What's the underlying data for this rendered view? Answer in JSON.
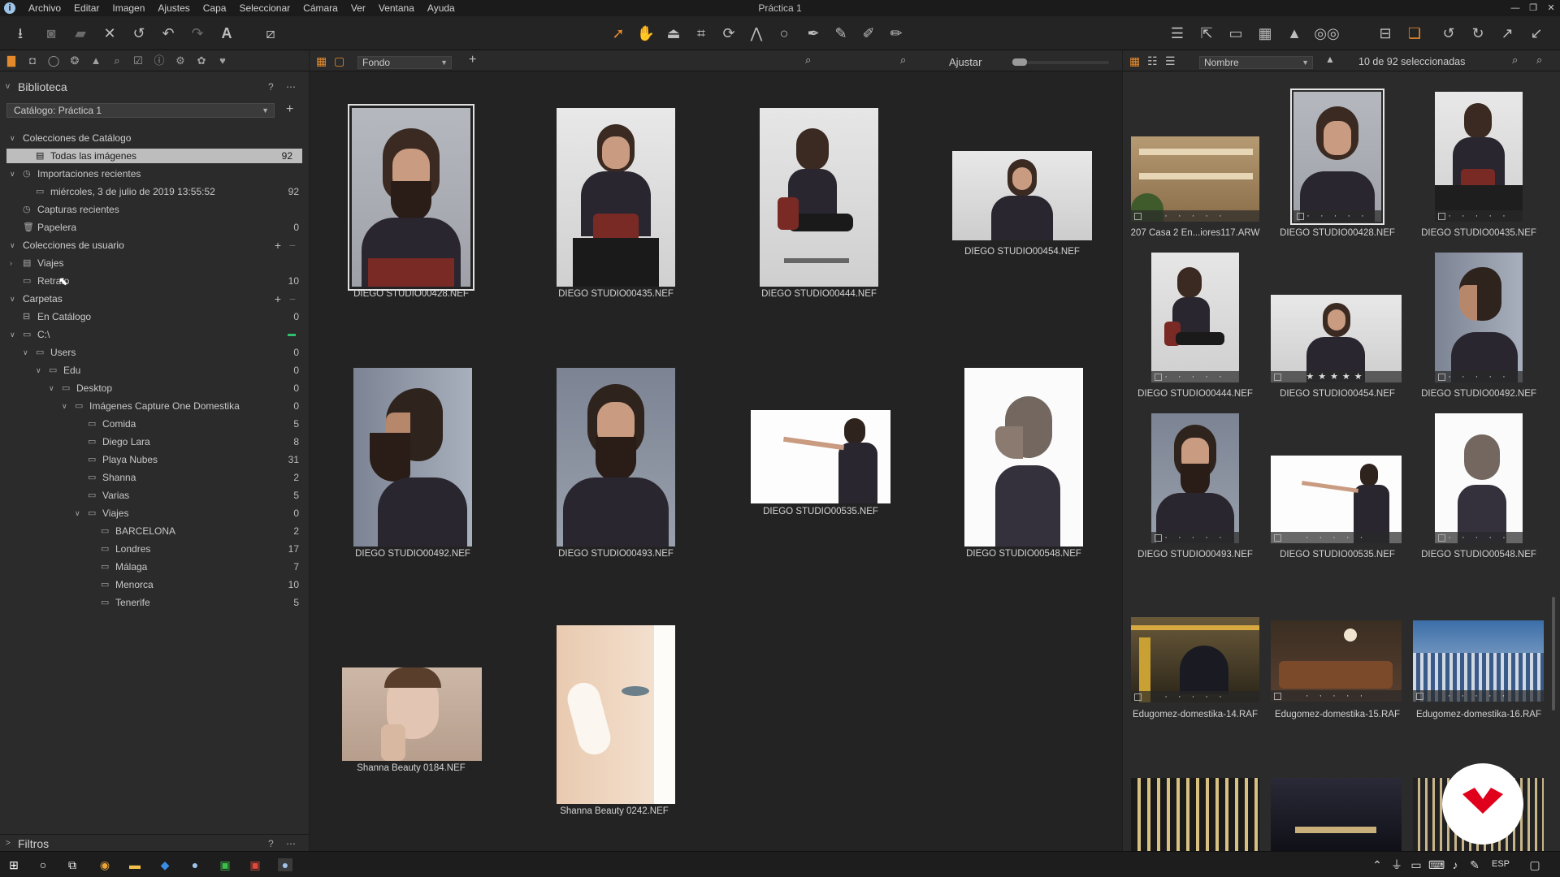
{
  "menu": [
    "Archivo",
    "Editar",
    "Imagen",
    "Ajustes",
    "Capa",
    "Seleccionar",
    "Cámara",
    "Ver",
    "Ventana",
    "Ayuda"
  ],
  "window_title": "Práctica 1",
  "library": {
    "title": "Biblioteca",
    "catalog": "Catálogo: Práctica 1"
  },
  "tree": [
    {
      "label": "Colecciones de Catálogo",
      "count": "",
      "indent": 0,
      "chev": "v",
      "icon": "",
      "section": true
    },
    {
      "label": "Todas las imágenes",
      "count": "92",
      "indent": 1,
      "chev": "",
      "icon": "all-images-icon",
      "selected": true
    },
    {
      "label": "Importaciones recientes",
      "count": "",
      "indent": 0,
      "chev": "v",
      "icon": "clock-icon"
    },
    {
      "label": "miércoles, 3 de julio de 2019 13:55:52",
      "count": "92",
      "indent": 1,
      "chev": "",
      "icon": "import-icon"
    },
    {
      "label": "Capturas recientes",
      "count": "",
      "indent": 0,
      "chev": "",
      "icon": "clock-icon"
    },
    {
      "label": "Papelera",
      "count": "0",
      "indent": 0,
      "chev": "",
      "icon": "trash-icon"
    },
    {
      "label": "Colecciones de usuario",
      "count": "",
      "indent": 0,
      "chev": "v",
      "icon": "",
      "section": true,
      "plusminus": true
    },
    {
      "label": "Viajes",
      "count": "",
      "indent": 0,
      "chev": ">",
      "icon": "project-icon"
    },
    {
      "label": "Retrato",
      "count": "10",
      "indent": 0,
      "chev": "",
      "icon": "album-icon"
    },
    {
      "label": "Carpetas",
      "count": "",
      "indent": 0,
      "chev": "v",
      "icon": "",
      "section": true,
      "plusminus": true
    },
    {
      "label": "En Catálogo",
      "count": "0",
      "indent": 0,
      "chev": "",
      "icon": "catalog-icon"
    },
    {
      "label": "C:\\",
      "count": "",
      "indent": 0,
      "chev": "v",
      "icon": "drive-icon",
      "green": true
    },
    {
      "label": "Users",
      "count": "0",
      "indent": 1,
      "chev": "v",
      "icon": "folder-icon"
    },
    {
      "label": "Edu",
      "count": "0",
      "indent": 2,
      "chev": "v",
      "icon": "folder-icon"
    },
    {
      "label": "Desktop",
      "count": "0",
      "indent": 3,
      "chev": "v",
      "icon": "folder-icon"
    },
    {
      "label": "Imágenes Capture One Domestika",
      "count": "0",
      "indent": 4,
      "chev": "v",
      "icon": "folder-icon"
    },
    {
      "label": "Comida",
      "count": "5",
      "indent": 5,
      "chev": "",
      "icon": "folder-icon"
    },
    {
      "label": "Diego Lara",
      "count": "8",
      "indent": 5,
      "chev": "",
      "icon": "folder-icon"
    },
    {
      "label": "Playa Nubes",
      "count": "31",
      "indent": 5,
      "chev": "",
      "icon": "folder-icon"
    },
    {
      "label": "Shanna",
      "count": "2",
      "indent": 5,
      "chev": "",
      "icon": "folder-icon"
    },
    {
      "label": "Varias",
      "count": "5",
      "indent": 5,
      "chev": "",
      "icon": "folder-icon"
    },
    {
      "label": "Viajes",
      "count": "0",
      "indent": 5,
      "chev": "v",
      "icon": "folder-icon"
    },
    {
      "label": "BARCELONA",
      "count": "2",
      "indent": 6,
      "chev": "",
      "icon": "folder-icon"
    },
    {
      "label": "Londres",
      "count": "17",
      "indent": 6,
      "chev": "",
      "icon": "folder-icon"
    },
    {
      "label": "Málaga",
      "count": "7",
      "indent": 6,
      "chev": "",
      "icon": "folder-icon"
    },
    {
      "label": "Menorca",
      "count": "10",
      "indent": 6,
      "chev": "",
      "icon": "folder-icon"
    },
    {
      "label": "Tenerife",
      "count": "5",
      "indent": 6,
      "chev": "",
      "icon": "folder-icon"
    }
  ],
  "filters": {
    "title": "Filtros"
  },
  "viewer": {
    "background": "Fondo",
    "fit_label": "Ajustar",
    "images": [
      {
        "name": "DIEGO STUDIO00428.NEF",
        "selected": true
      },
      {
        "name": "DIEGO STUDIO00435.NEF"
      },
      {
        "name": "DIEGO STUDIO00444.NEF"
      },
      {
        "name": "DIEGO STUDIO00454.NEF"
      },
      {
        "name": "DIEGO STUDIO00492.NEF"
      },
      {
        "name": "DIEGO STUDIO00493.NEF"
      },
      {
        "name": "DIEGO STUDIO00535.NEF"
      },
      {
        "name": "DIEGO STUDIO00548.NEF"
      },
      {
        "name": "Shanna Beauty 0184.NEF"
      },
      {
        "name": "Shanna Beauty 0242.NEF"
      }
    ]
  },
  "browser": {
    "sort": "Nombre",
    "selection": "10 de 92 seleccionadas",
    "items": [
      {
        "name": "207 Casa 2 En...iores117.ARW",
        "rating": "· · · · ·"
      },
      {
        "name": "DIEGO STUDIO00428.NEF",
        "rating": "· · · · ·",
        "selected": true
      },
      {
        "name": "DIEGO STUDIO00435.NEF",
        "rating": "· · · · ·"
      },
      {
        "name": "DIEGO STUDIO00444.NEF",
        "rating": "· · · · ·"
      },
      {
        "name": "DIEGO STUDIO00454.NEF",
        "rating": "★★★★★"
      },
      {
        "name": "DIEGO STUDIO00492.NEF",
        "rating": "· · · · ·"
      },
      {
        "name": "DIEGO STUDIO00493.NEF",
        "rating": "· · · · ·"
      },
      {
        "name": "DIEGO STUDIO00535.NEF",
        "rating": "· · · · ·"
      },
      {
        "name": "DIEGO STUDIO00548.NEF",
        "rating": "· · · · ·"
      },
      {
        "name": "Edugomez-domestika-14.RAF",
        "rating": "· · · · ·"
      },
      {
        "name": "Edugomez-domestika-15.RAF",
        "rating": "· · · · ·"
      },
      {
        "name": "Edugomez-domestika-16.RAF",
        "rating": "· · · · ·"
      }
    ]
  },
  "taskbar": {
    "language": "ESP"
  },
  "colors": {
    "accent": "#e48a2c",
    "selection": "#bdbdbd",
    "brand_red": "#e0001b",
    "status_green": "#2fbf6d"
  }
}
